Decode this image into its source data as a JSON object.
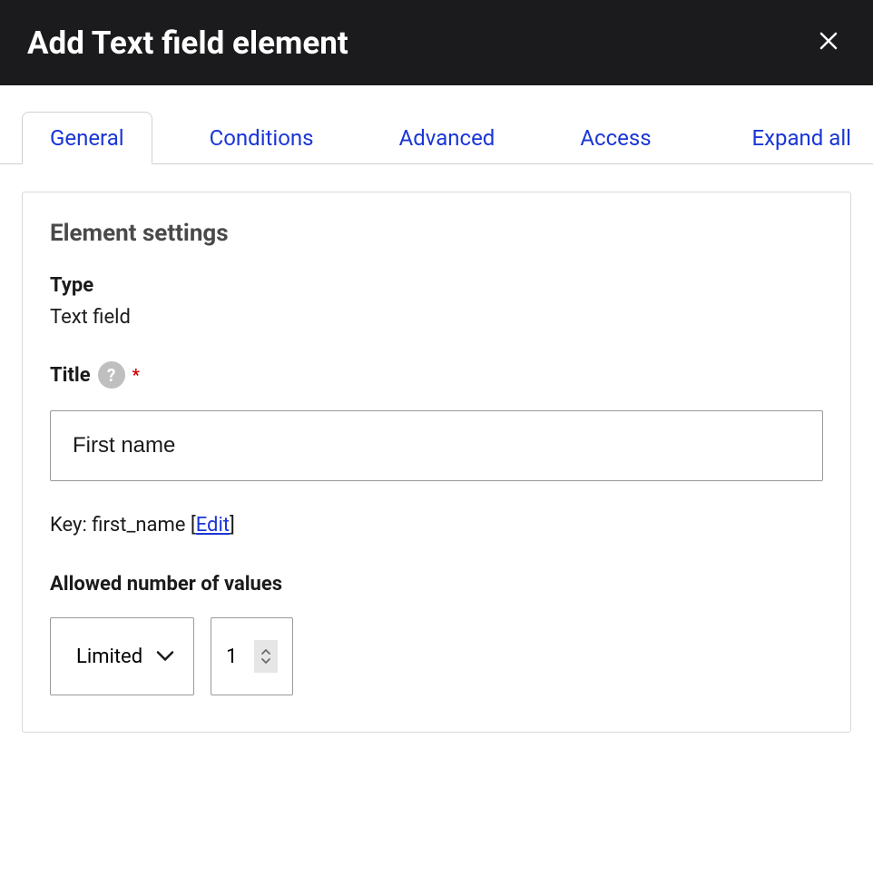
{
  "header": {
    "title": "Add Text field element"
  },
  "tabs": {
    "items": [
      {
        "label": "General"
      },
      {
        "label": "Conditions"
      },
      {
        "label": "Advanced"
      },
      {
        "label": "Access"
      }
    ],
    "expand_all": "Expand all"
  },
  "panel": {
    "title": "Element settings",
    "type_label": "Type",
    "type_value": "Text field",
    "title_label": "Title",
    "title_help": "?",
    "title_required": "*",
    "title_value": "First name",
    "key_prefix": "Key: ",
    "key_value": "first_name",
    "key_edit_open": " [",
    "key_edit_link": "Edit",
    "key_edit_close": "]",
    "allowed_label": "Allowed number of values",
    "allowed_select": "Limited",
    "allowed_number": "1"
  }
}
